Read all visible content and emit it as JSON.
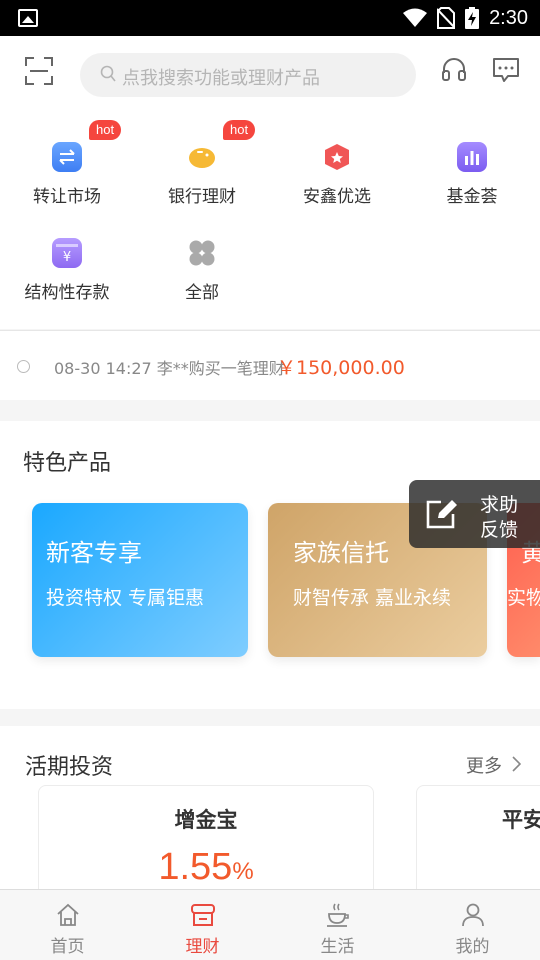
{
  "status_bar": {
    "time": "2:30"
  },
  "header": {
    "search_placeholder": "点我搜索功能或理财产品"
  },
  "quick_menu": [
    {
      "label": "转让市场",
      "icon": "transfer-market-icon",
      "hot": "hot",
      "color": "#4a8cf7"
    },
    {
      "label": "银行理财",
      "icon": "piggy-bank-icon",
      "hot": "hot",
      "color": "#f6b935"
    },
    {
      "label": "安鑫优选",
      "icon": "medal-icon",
      "hot": "",
      "color": "#f05656"
    },
    {
      "label": "基金荟",
      "icon": "bar-chart-icon",
      "hot": "",
      "color": "#8d6cf2"
    },
    {
      "label": "结构性存款",
      "icon": "deposit-box-icon",
      "hot": "",
      "color": "#9c78f0"
    },
    {
      "label": "全部",
      "icon": "grid-all-icon",
      "hot": "",
      "color": "#aaaaaa"
    }
  ],
  "ticker": {
    "text": "08-30 14:27 李**购买一笔理财",
    "amount": "￥150,000.00"
  },
  "featured": {
    "title": "特色产品",
    "cards": [
      {
        "title": "新客专享",
        "subtitle": "投资特权 专属钜惠"
      },
      {
        "title": "家族信托",
        "subtitle": "财智传承 嘉业永续"
      },
      {
        "title": "黄",
        "subtitle": "实物"
      }
    ]
  },
  "feedback": {
    "line1": "求助",
    "line2": "反馈"
  },
  "demand": {
    "title": "活期投资",
    "more": "更多",
    "cards": [
      {
        "name": "增金宝",
        "rate": "1.55",
        "unit": "%"
      },
      {
        "name": "平安",
        "rate": "",
        "unit": ""
      }
    ]
  },
  "tabbar": [
    {
      "label": "首页",
      "active": false
    },
    {
      "label": "理财",
      "active": true
    },
    {
      "label": "生活",
      "active": false
    },
    {
      "label": "我的",
      "active": false
    }
  ],
  "colors": {
    "accent": "#e94a3f",
    "amount": "#f25a2c",
    "hot": "#f5463e"
  }
}
